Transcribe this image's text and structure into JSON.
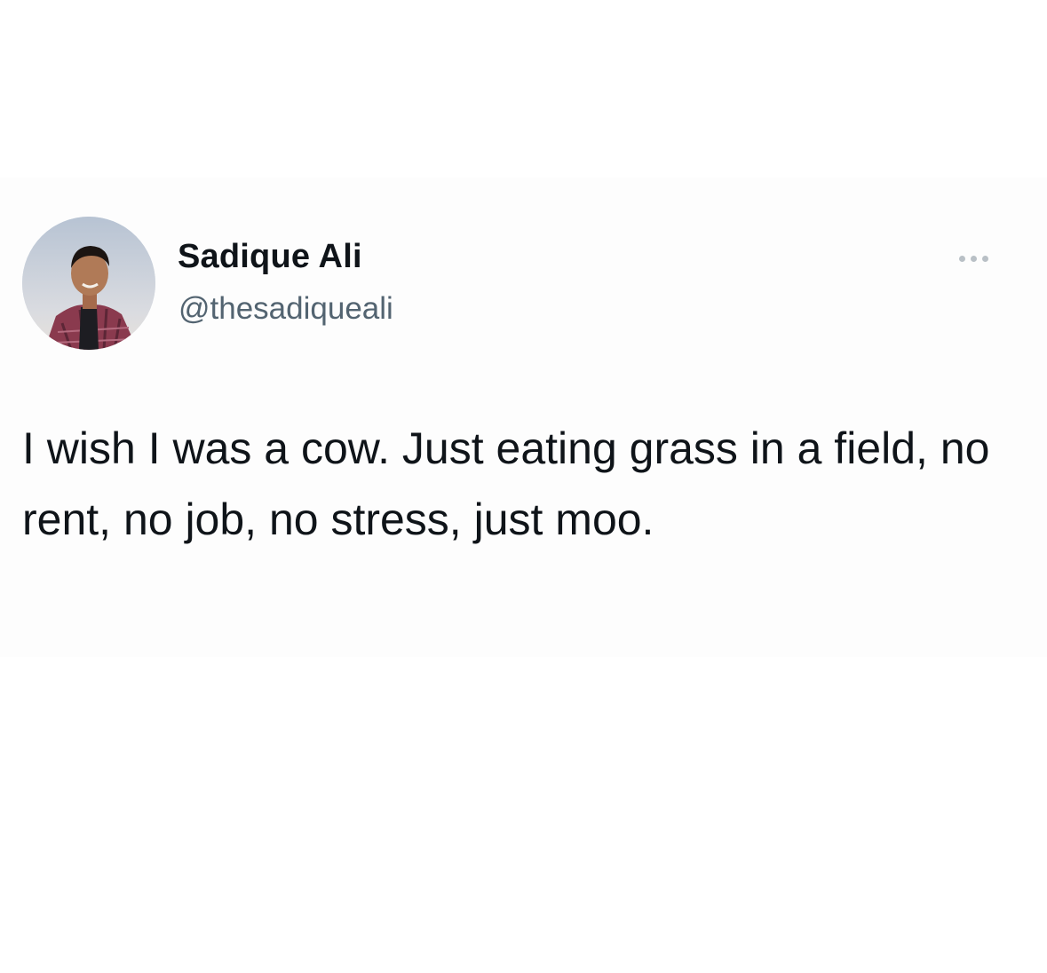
{
  "tweet": {
    "author": {
      "display_name": "Sadique Ali",
      "handle": "@thesadiqueali",
      "avatar": "profile-photo"
    },
    "text": "I wish I was a cow. Just eating grass in a field, no rent, no job, no stress, just moo.",
    "more_icon": "more-horizontal-icon"
  },
  "colors": {
    "background": "#ffffff",
    "text_primary": "#0f1419",
    "text_secondary": "#536471",
    "icon_muted": "#b9c0c6"
  }
}
